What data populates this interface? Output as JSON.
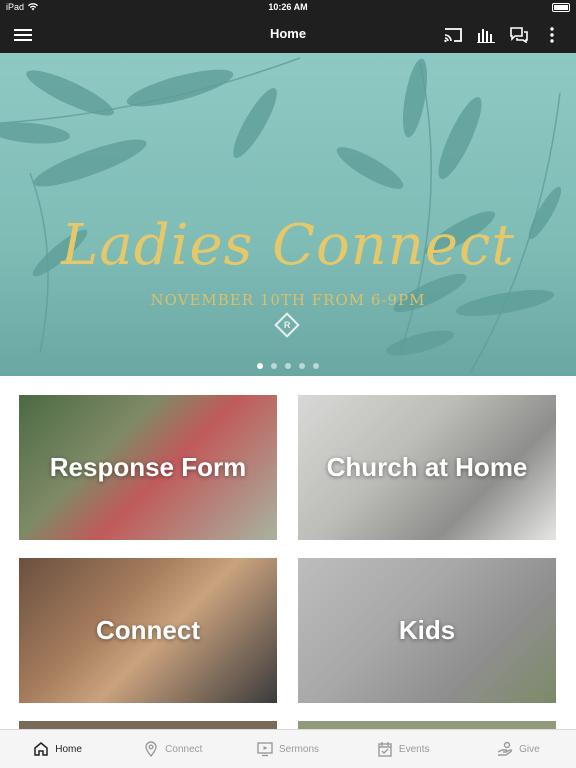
{
  "status_bar": {
    "device": "iPad",
    "time": "10:26 AM"
  },
  "app_bar": {
    "title": "Home"
  },
  "hero": {
    "title": "Ladies Connect",
    "subtitle": "NOVEMBER 10TH FROM 6-9PM",
    "logo_letter": "R",
    "slide_count": 5,
    "active_slide": 1
  },
  "tiles": [
    {
      "label": "Response Form"
    },
    {
      "label": "Church at Home"
    },
    {
      "label": "Connect"
    },
    {
      "label": "Kids"
    }
  ],
  "tab_bar": {
    "items": [
      {
        "label": "Home",
        "icon": "home-icon",
        "active": true
      },
      {
        "label": "Connect",
        "icon": "location-pin-icon",
        "active": false
      },
      {
        "label": "Sermons",
        "icon": "tv-play-icon",
        "active": false
      },
      {
        "label": "Events",
        "icon": "calendar-check-icon",
        "active": false
      },
      {
        "label": "Give",
        "icon": "give-hand-icon",
        "active": false
      }
    ]
  }
}
